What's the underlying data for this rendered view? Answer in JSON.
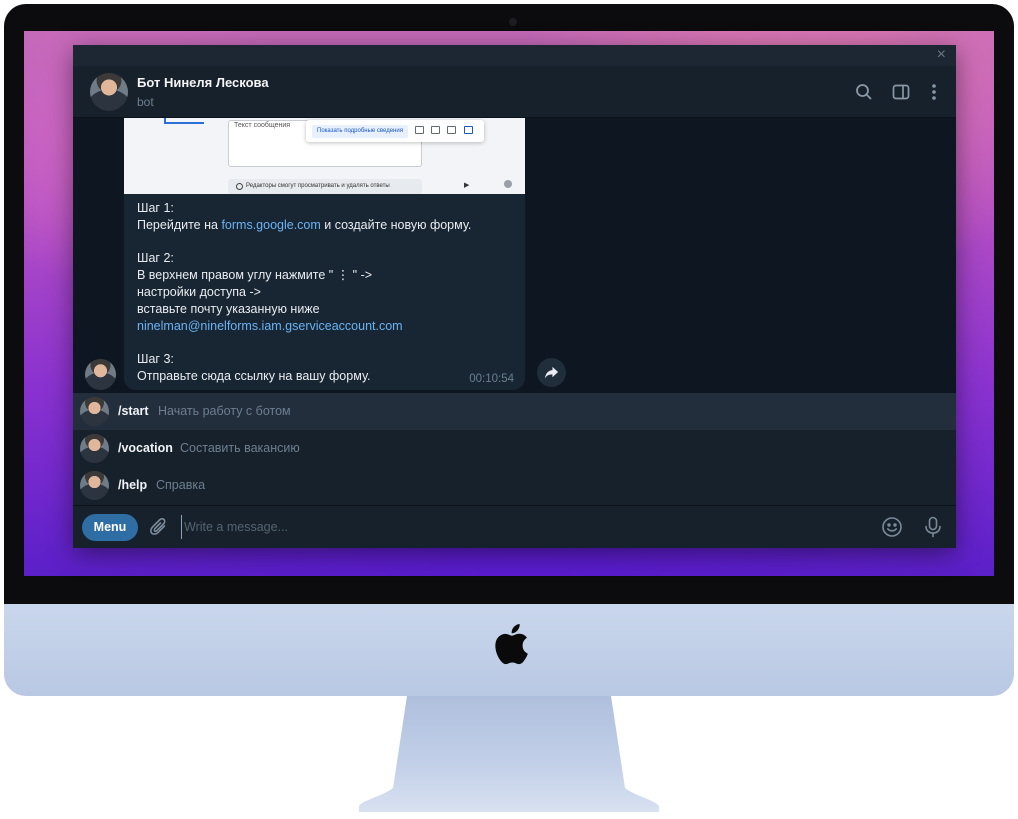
{
  "window": {
    "close_glyph": "×"
  },
  "chat": {
    "name": "Бот Нинеля Лескова",
    "status": "bot"
  },
  "header_icons": [
    "search-icon",
    "sidebar-toggle-icon",
    "more-vertical-icon"
  ],
  "message": {
    "screenshot": {
      "textarea_label": "Текст сообщения",
      "popup_button": "Показать подробные сведения",
      "info_bar": "Редакторы смогут просматривать и удалять ответы"
    },
    "step1_title": "Шаг 1:",
    "step1_prefix": "Перейдите на ",
    "step1_link": "forms.google.com",
    "step1_suffix": " и создайте новую форму.",
    "step2_title": "Шаг 2:",
    "step2_line1": "В верхнем правом углу нажмите \" ⋮ \" ->",
    "step2_line2": "настройки доступа ->",
    "step2_line3": "вставьте почту указанную ниже",
    "step2_email": "ninelman@ninelforms.iam.gserviceaccount.com",
    "step3_title": "Шаг 3:",
    "step3_line1": "Отправьте сюда ссылку на вашу форму.",
    "time": "00:10:54"
  },
  "commands": [
    {
      "name": "/start",
      "description": "Начать работу с ботом"
    },
    {
      "name": "/vocation",
      "description": "Составить вакансию"
    },
    {
      "name": "/help",
      "description": "Справка"
    }
  ],
  "composer": {
    "menu_label": "Menu",
    "placeholder": "Write a message..."
  },
  "colors": {
    "accent": "#2f6ea5",
    "link": "#6ab3f3",
    "chat_bg": "#0e1621",
    "panel_bg": "#17212b",
    "bubble_bg": "#182533"
  }
}
